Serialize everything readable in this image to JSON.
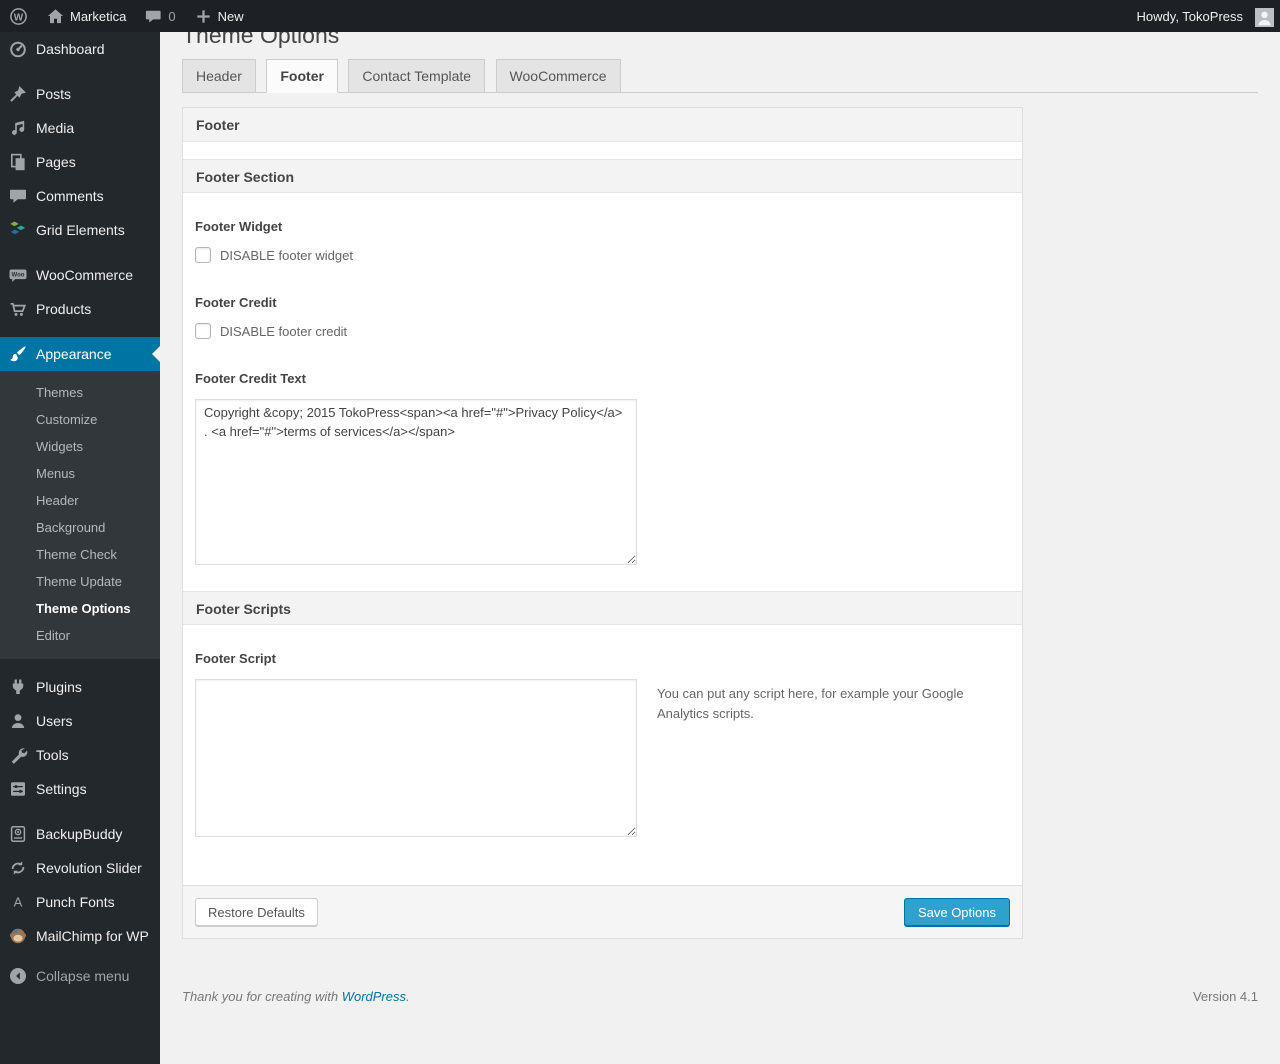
{
  "admin_bar": {
    "site_name": "Marketica",
    "comments_count": "0",
    "new_label": "New",
    "howdy": "Howdy, TokoPress"
  },
  "sidebar": {
    "items": [
      {
        "label": "Dashboard"
      },
      {
        "label": "Posts"
      },
      {
        "label": "Media"
      },
      {
        "label": "Pages"
      },
      {
        "label": "Comments"
      },
      {
        "label": "Grid Elements"
      },
      {
        "label": "WooCommerce"
      },
      {
        "label": "Products"
      },
      {
        "label": "Appearance"
      },
      {
        "label": "Plugins"
      },
      {
        "label": "Users"
      },
      {
        "label": "Tools"
      },
      {
        "label": "Settings"
      },
      {
        "label": "BackupBuddy"
      },
      {
        "label": "Revolution Slider"
      },
      {
        "label": "Punch Fonts"
      },
      {
        "label": "MailChimp for WP"
      },
      {
        "label": "Collapse menu"
      }
    ],
    "appearance_submenu": [
      "Themes",
      "Customize",
      "Widgets",
      "Menus",
      "Header",
      "Background",
      "Theme Check",
      "Theme Update",
      "Theme Options",
      "Editor"
    ],
    "active_item": "Appearance",
    "active_submenu": "Theme Options"
  },
  "main": {
    "title": "Theme Options",
    "tabs": [
      "Header",
      "Footer",
      "Contact Template",
      "WooCommerce"
    ],
    "active_tab": "Footer"
  },
  "footer_box": {
    "title": "Footer",
    "section_title": "Footer Section",
    "fields": {
      "footer_widget_label": "Footer Widget",
      "footer_widget_checkbox_label": "DISABLE footer widget",
      "footer_widget_checked": false,
      "footer_credit_label": "Footer Credit",
      "footer_credit_checkbox_label": "DISABLE footer credit",
      "footer_credit_checked": false,
      "footer_credit_text_label": "Footer Credit Text",
      "footer_credit_text_value": "Copyright &copy; 2015 TokoPress<span><a href=\"#\">Privacy Policy</a> . <a href=\"#\">terms of services</a></span>",
      "scripts_section_title": "Footer Scripts",
      "footer_script_label": "Footer Script",
      "footer_script_value": "",
      "footer_script_help": "You can put any script here, for example your Google Analytics scripts."
    },
    "buttons": {
      "restore": "Restore Defaults",
      "save": "Save Options"
    }
  },
  "page_footer": {
    "thanks_prefix": "Thank you for creating with ",
    "wordpress_link": "WordPress",
    "thanks_suffix": ".",
    "version": "Version 4.1"
  },
  "colors": {
    "accent_blue": "#0074a2",
    "primary_button": "#2ea2cc",
    "menu_dark": "#23282d"
  }
}
